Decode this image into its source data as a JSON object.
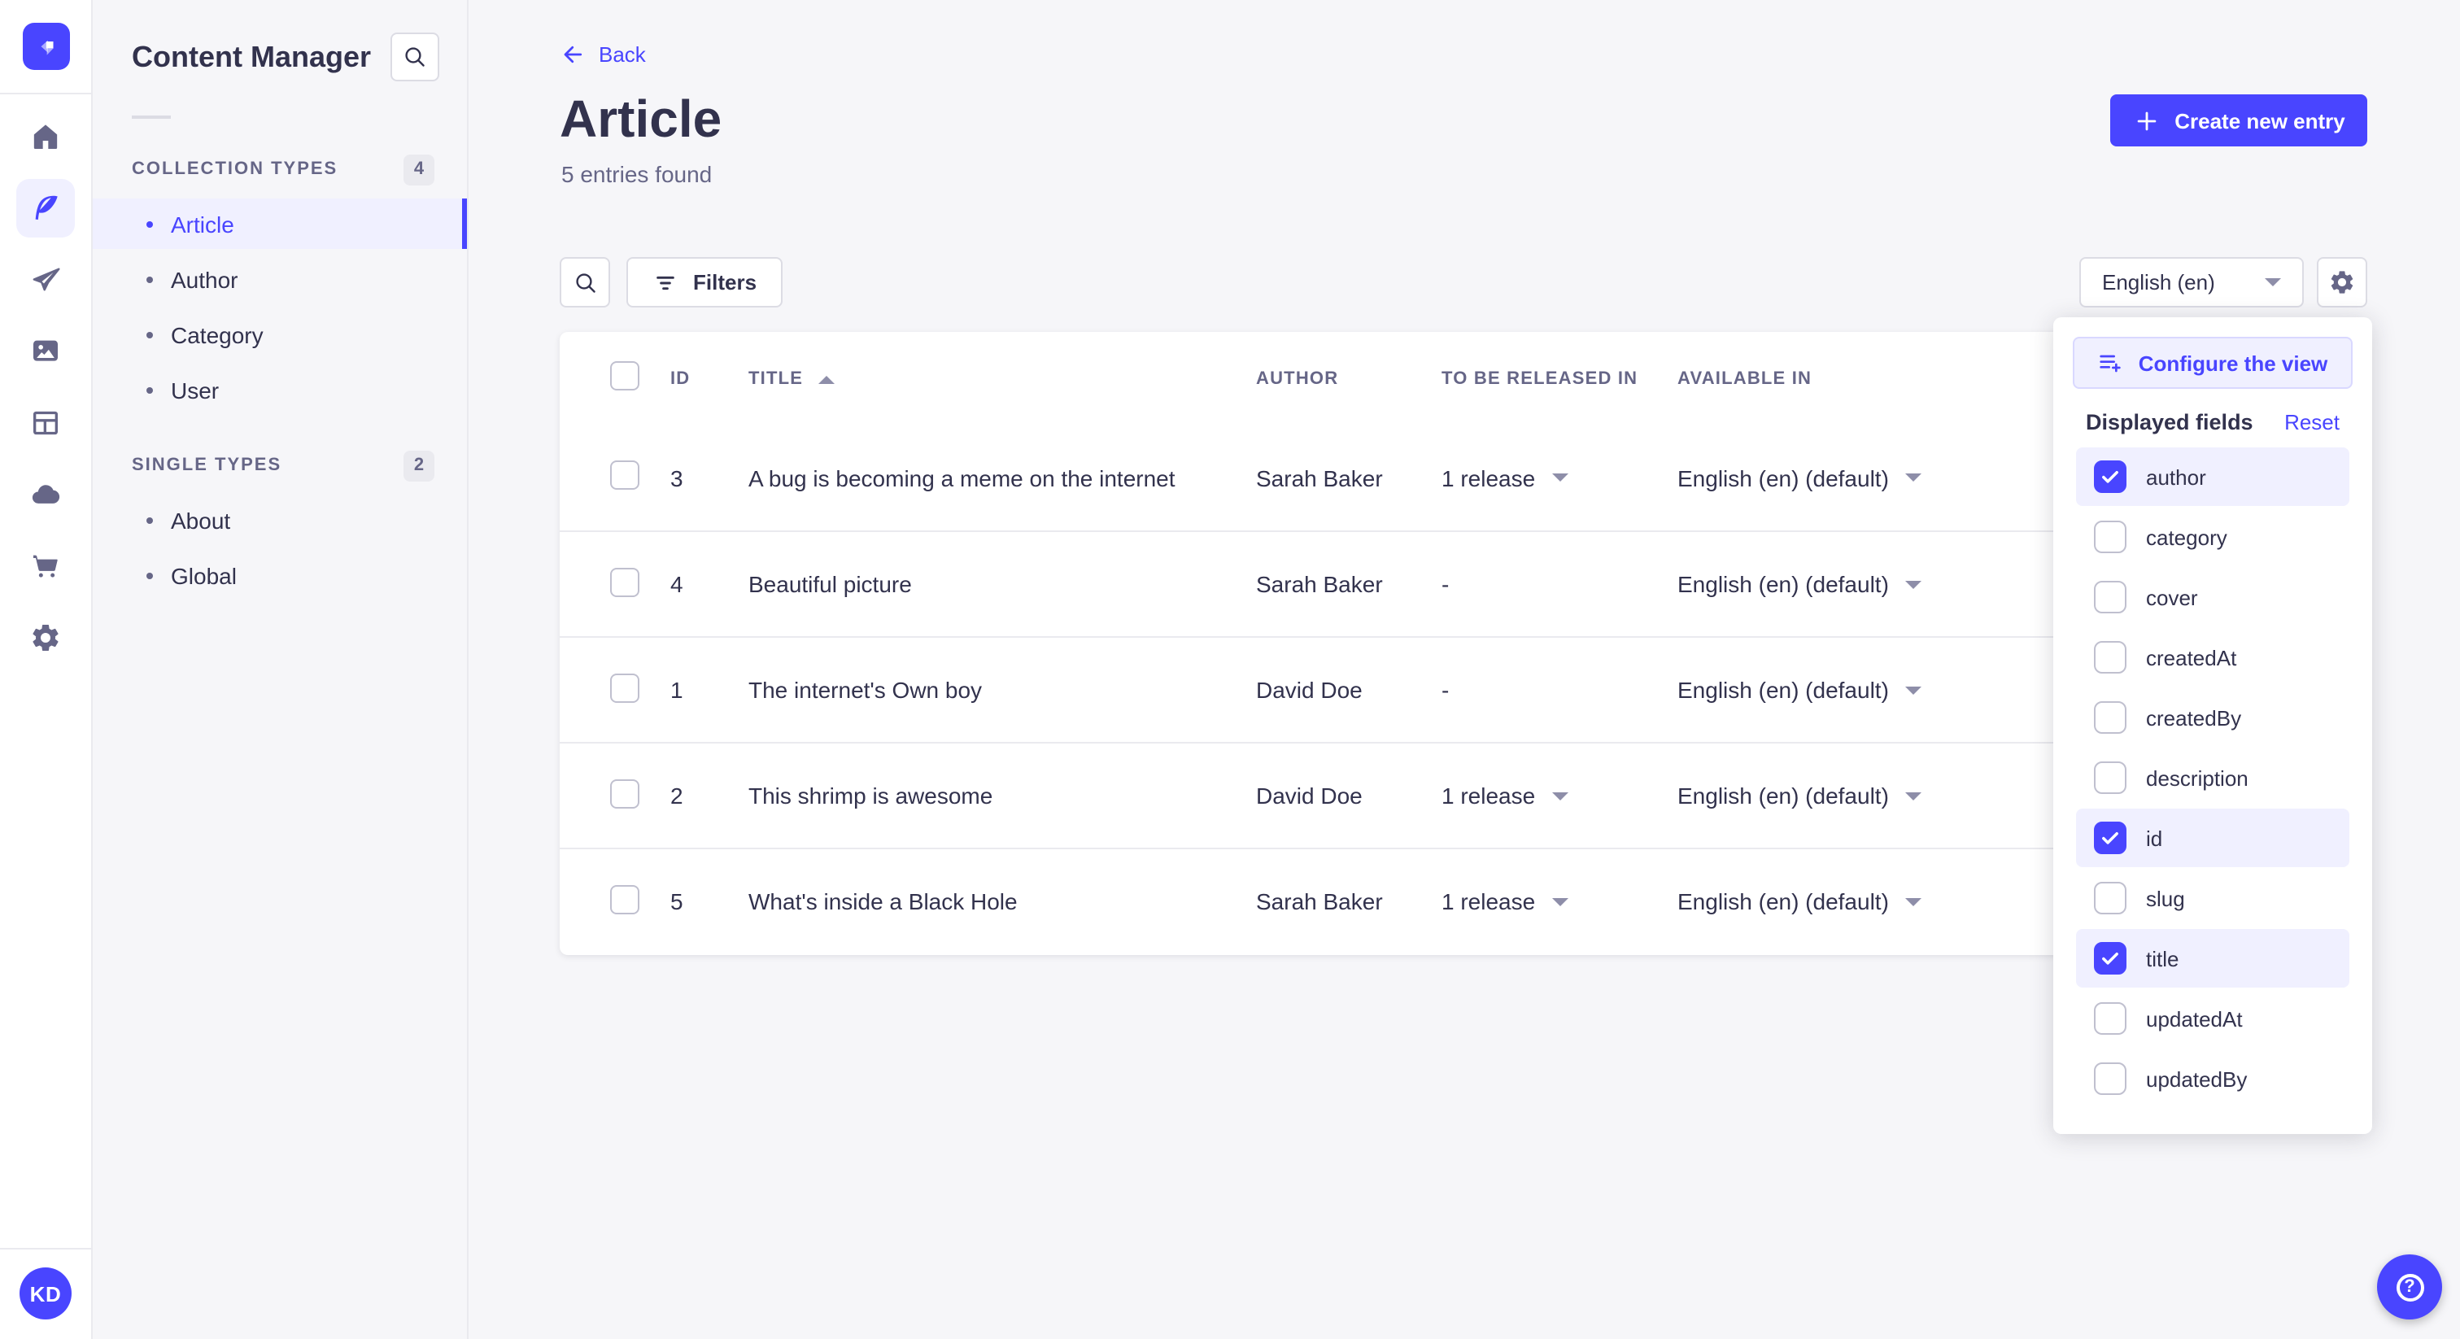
{
  "colors": {
    "primary": "#4945ff",
    "primary_light": "#f0f0ff",
    "text_dark": "#32324d",
    "text_muted": "#666687"
  },
  "nav_rail": {
    "items": [
      {
        "icon": "home",
        "active": false
      },
      {
        "icon": "content-manager",
        "active": true
      },
      {
        "icon": "releases",
        "active": false
      },
      {
        "icon": "media-library",
        "active": false
      },
      {
        "icon": "content-type-builder",
        "active": false
      },
      {
        "icon": "cloud",
        "active": false
      },
      {
        "icon": "marketplace",
        "active": false
      },
      {
        "icon": "settings",
        "active": false
      }
    ],
    "avatar_initials": "KD"
  },
  "sidebar": {
    "title": "Content Manager",
    "sections": [
      {
        "label": "COLLECTION TYPES",
        "badge": "4",
        "items": [
          {
            "label": "Article",
            "active": true
          },
          {
            "label": "Author",
            "active": false
          },
          {
            "label": "Category",
            "active": false
          },
          {
            "label": "User",
            "active": false
          }
        ]
      },
      {
        "label": "SINGLE TYPES",
        "badge": "2",
        "items": [
          {
            "label": "About",
            "active": false
          },
          {
            "label": "Global",
            "active": false
          }
        ]
      }
    ]
  },
  "header": {
    "back": "Back",
    "title": "Article",
    "subtitle": "5 entries found",
    "create_button": "Create new entry"
  },
  "toolbar": {
    "filters": "Filters",
    "locale": "English (en)"
  },
  "table": {
    "headers": [
      "ID",
      "TITLE",
      "AUTHOR",
      "TO BE RELEASED IN",
      "AVAILABLE IN"
    ],
    "sort": {
      "column": "TITLE",
      "direction": "asc"
    },
    "rows": [
      {
        "id": "3",
        "title": "A bug is becoming a meme on the internet",
        "author": "Sarah Baker",
        "released": "1 release",
        "released_caret": true,
        "available": "English (en) (default)"
      },
      {
        "id": "4",
        "title": "Beautiful picture",
        "author": "Sarah Baker",
        "released": "-",
        "released_caret": false,
        "available": "English (en) (default)"
      },
      {
        "id": "1",
        "title": "The internet's Own boy",
        "author": "David Doe",
        "released": "-",
        "released_caret": false,
        "available": "English (en) (default)"
      },
      {
        "id": "2",
        "title": "This shrimp is awesome",
        "author": "David Doe",
        "released": "1 release",
        "released_caret": true,
        "available": "English (en) (default)"
      },
      {
        "id": "5",
        "title": "What's inside a Black Hole",
        "author": "Sarah Baker",
        "released": "1 release",
        "released_caret": true,
        "available": "English (en) (default)"
      }
    ]
  },
  "view_popup": {
    "configure_button": "Configure the view",
    "heading": "Displayed fields",
    "reset": "Reset",
    "fields": [
      {
        "label": "author",
        "checked": true
      },
      {
        "label": "category",
        "checked": false
      },
      {
        "label": "cover",
        "checked": false
      },
      {
        "label": "createdAt",
        "checked": false
      },
      {
        "label": "createdBy",
        "checked": false
      },
      {
        "label": "description",
        "checked": false
      },
      {
        "label": "id",
        "checked": true
      },
      {
        "label": "slug",
        "checked": false
      },
      {
        "label": "title",
        "checked": true
      },
      {
        "label": "updatedAt",
        "checked": false
      },
      {
        "label": "updatedBy",
        "checked": false
      }
    ]
  }
}
